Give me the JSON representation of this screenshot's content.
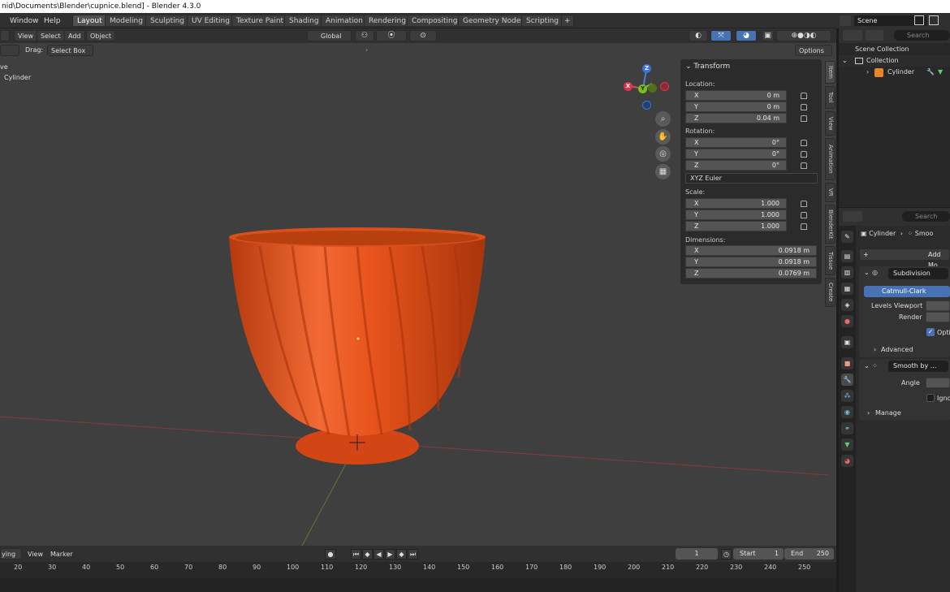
{
  "window": {
    "title": "nid\\Documents\\Blender\\cupnice.blend] - Blender 4.3.0"
  },
  "menu": {
    "items": [
      "Window",
      "Help"
    ]
  },
  "workspace_tabs": [
    "Layout",
    "Modeling",
    "Sculpting",
    "UV Editing",
    "Texture Paint",
    "Shading",
    "Animation",
    "Rendering",
    "Compositing",
    "Geometry Nodes",
    "Scripting",
    "+"
  ],
  "active_workspace": "Layout",
  "scene": {
    "label": "Scene"
  },
  "viewport": {
    "menus": [
      "View",
      "Select",
      "Add",
      "Object"
    ],
    "orientation": "Global",
    "drag_label": "Drag:",
    "drag_value": "Select Box",
    "options_label": "Options",
    "overlay_text_1": "ve",
    "overlay_text_2": "Cylinder"
  },
  "npanel": {
    "title": "Transform",
    "location_label": "Location:",
    "location": [
      {
        "axis": "X",
        "value": "0 m"
      },
      {
        "axis": "Y",
        "value": "0 m"
      },
      {
        "axis": "Z",
        "value": "0.04 m"
      }
    ],
    "rotation_label": "Rotation:",
    "rotation": [
      {
        "axis": "X",
        "value": "0°"
      },
      {
        "axis": "Y",
        "value": "0°"
      },
      {
        "axis": "Z",
        "value": "0°"
      }
    ],
    "rotation_mode": "XYZ Euler",
    "scale_label": "Scale:",
    "scale": [
      {
        "axis": "X",
        "value": "1.000"
      },
      {
        "axis": "Y",
        "value": "1.000"
      },
      {
        "axis": "Z",
        "value": "1.000"
      }
    ],
    "dimensions_label": "Dimensions:",
    "dimensions": [
      {
        "axis": "X",
        "value": "0.0918 m"
      },
      {
        "axis": "Y",
        "value": "0.0918 m"
      },
      {
        "axis": "Z",
        "value": "0.0769 m"
      }
    ]
  },
  "sidebar_tabs": [
    "Item",
    "Tool",
    "View",
    "Animation",
    "VR",
    "BlenderKit",
    "Tissue",
    "Create"
  ],
  "outliner": {
    "search_placeholder": "Search",
    "rows": [
      "Scene Collection",
      "Collection",
      "Cylinder"
    ]
  },
  "properties": {
    "search_placeholder": "Search",
    "breadcrumb_object": "Cylinder",
    "breadcrumb_modifier": "Smoo",
    "add_modifier": "Add Mo",
    "subdivision": {
      "name": "Subdivision",
      "type_active": "Catmull-Clark",
      "levels_viewport_label": "Levels Viewport",
      "render_label": "Render",
      "optimal_label": "Optin",
      "advanced_label": "Advanced"
    },
    "smooth": {
      "name": "Smooth by ...",
      "angle_label": "Angle",
      "ignore_label": "Igno",
      "manage_label": "Manage"
    }
  },
  "timeline": {
    "menus": [
      "ying",
      "View",
      "Marker"
    ],
    "current_frame": "1",
    "start_label": "Start",
    "start_value": "1",
    "end_label": "End",
    "end_value": "250",
    "ticks": [
      "20",
      "30",
      "40",
      "50",
      "60",
      "70",
      "80",
      "90",
      "100",
      "110",
      "120",
      "130",
      "140",
      "150",
      "160",
      "170",
      "180",
      "190",
      "200",
      "210",
      "220",
      "230",
      "240",
      "250"
    ]
  },
  "gizmo": {
    "x": "X",
    "y": "Y",
    "z": "Z"
  },
  "colors": {
    "accent_blue": "#4772b3",
    "object_orange": "#e8541c",
    "viewport_bg": "#3f3f3f"
  }
}
